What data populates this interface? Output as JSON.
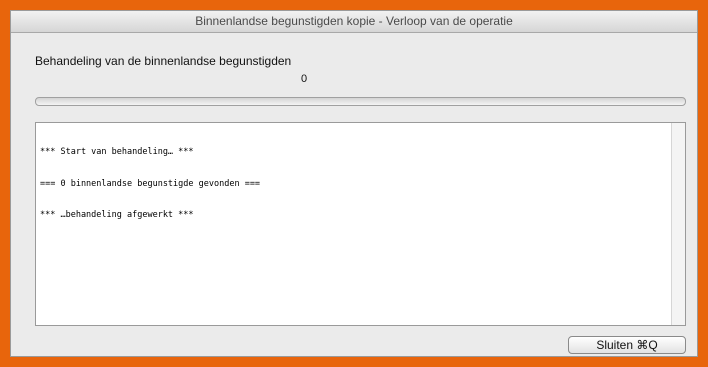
{
  "window": {
    "title": "Binnenlandse begunstigden kopie - Verloop van de operatie"
  },
  "main": {
    "heading": "Behandeling van de binnenlandse begunstigden",
    "counter": "0",
    "progress_fraction": 0,
    "log_lines": [
      "*** Start van behandeling… ***",
      "=== 0 binnenlandse begunstigde gevonden ===",
      "*** …behandeling afgewerkt ***"
    ]
  },
  "footer": {
    "close_label": "Sluiten ⌘Q"
  }
}
